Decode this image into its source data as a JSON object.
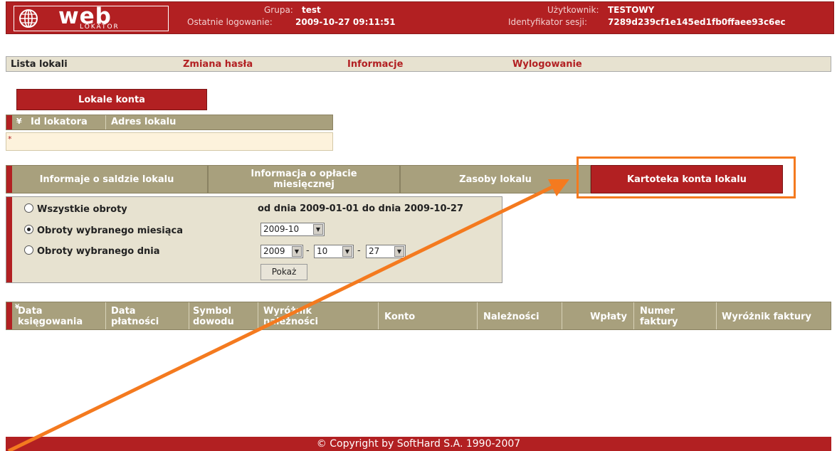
{
  "header": {
    "logo_text": "web",
    "logo_subtext": "LOKATOR",
    "group_label": "Grupa:",
    "group_value": "test",
    "last_login_label": "Ostatnie logowanie:",
    "last_login_value": "2009-10-27 09:11:51",
    "user_label": "Użytkownik:",
    "user_value": "TESTOWY",
    "session_label": "Identyfikator sesji:",
    "session_value": "7289d239cf1e145ed1fb0ffaee93c6ec"
  },
  "menu": {
    "items": [
      {
        "label": "Lista lokali",
        "color": "#222222"
      },
      {
        "label": "Zmiana hasła",
        "color": "#b22022"
      },
      {
        "label": "Informacje",
        "color": "#b22022"
      },
      {
        "label": "Wylogowanie",
        "color": "#b22022"
      }
    ]
  },
  "accounts": {
    "title": "Lokale konta",
    "col_sort_icon": "¥",
    "columns": [
      "Id lokatora",
      "Adres lokalu"
    ],
    "row_marker": "*"
  },
  "tabs": [
    {
      "label": "Informaje o saldzie lokalu"
    },
    {
      "label": "Informacja o opłacie miesięcznej"
    },
    {
      "label": "Zasoby lokalu"
    },
    {
      "label": "Kartoteka konta lokalu",
      "active": true
    }
  ],
  "filter": {
    "options": [
      {
        "label": "Wszystkie obroty",
        "checked": false
      },
      {
        "label": "Obroty wybranego miesiąca",
        "checked": true
      },
      {
        "label": "Obroty wybranego dnia",
        "checked": false
      }
    ],
    "range_text": "od dnia 2009-01-01 do dnia 2009-10-27",
    "month_value": "2009-10",
    "year_value": "2009",
    "day_month_value": "10",
    "day_value": "27",
    "dash": "-",
    "show_button": "Pokaż"
  },
  "results": {
    "columns": [
      "Data księgowania",
      "Data płatności",
      "Symbol dowodu",
      "Wyróżnik należności",
      "Konto",
      "Należności",
      "Wpłaty",
      "Numer faktury",
      "Wyróżnik faktury"
    ]
  },
  "footer": {
    "text": "© Copyright by SoftHard S.A. 1990-2007"
  },
  "colors": {
    "brand_red": "#b22022",
    "olive": "#a8a07d",
    "panel": "#e7e2d0",
    "highlight": "#f47a1f"
  }
}
